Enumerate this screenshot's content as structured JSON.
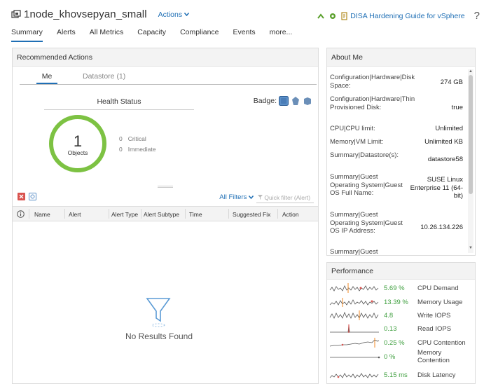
{
  "header": {
    "title": "1node_khovsepyan_small",
    "actions_label": "Actions",
    "guide_link": "DISA Hardening Guide for vSphere",
    "help": "?"
  },
  "tabs": [
    "Summary",
    "Alerts",
    "All Metrics",
    "Capacity",
    "Compliance",
    "Events",
    "more..."
  ],
  "recommended": {
    "title": "Recommended Actions",
    "subtabs": [
      "Me",
      "Datastore (1)"
    ],
    "health_title": "Health Status",
    "badge_label": "Badge:",
    "ring_count": "1",
    "ring_label": "Objects",
    "legend": [
      {
        "count": "0",
        "label": "Critical"
      },
      {
        "count": "0",
        "label": "Immediate"
      }
    ],
    "all_filters": "All Filters",
    "quick_filter_placeholder": "Quick filter (Alert)",
    "columns": [
      "Name",
      "Alert",
      "Alert Type",
      "Alert Subtype",
      "Time",
      "Suggested Fix",
      "Action"
    ],
    "empty_text": "No Results Found"
  },
  "about": {
    "title": "About Me",
    "rows": [
      {
        "key": "Configuration|Hardware|Disk Space:",
        "value": "274 GB"
      },
      {
        "key": "Configuration|Hardware|Thin Provisioned Disk:",
        "value": "true"
      },
      {
        "key": "CPU|CPU limit:",
        "value": "Unlimited"
      },
      {
        "key": "Memory|VM Limit:",
        "value": "Unlimited KB"
      },
      {
        "key": "Summary|Datastore(s):",
        "value": "datastore58"
      },
      {
        "key": "Summary|Guest Operating System|Guest OS Full Name:",
        "value": "SUSE Linux Enterprise 11 (64-bit)"
      },
      {
        "key": "Summary|Guest Operating System|Guest OS IP Address:",
        "value": "10.26.134.226"
      },
      {
        "key": "Summary|Guest",
        "value": ""
      }
    ]
  },
  "performance": {
    "title": "Performance",
    "metrics": [
      {
        "value": "5.69 %",
        "label": "CPU Demand"
      },
      {
        "value": "13.39 %",
        "label": "Memory Usage"
      },
      {
        "value": "4.8",
        "label": "Write IOPS"
      },
      {
        "value": "0.13",
        "label": "Read IOPS"
      },
      {
        "value": "0.25 %",
        "label": "CPU Contention"
      },
      {
        "value": "0 %",
        "label": "Memory Contention"
      },
      {
        "value": "5.15 ms",
        "label": "Disk Latency"
      }
    ]
  },
  "colors": {
    "accent": "#1f6fb5",
    "health_green": "#7dc243",
    "value_green": "#3f9f3f",
    "red": "#d9534f",
    "orange": "#f08a24"
  }
}
